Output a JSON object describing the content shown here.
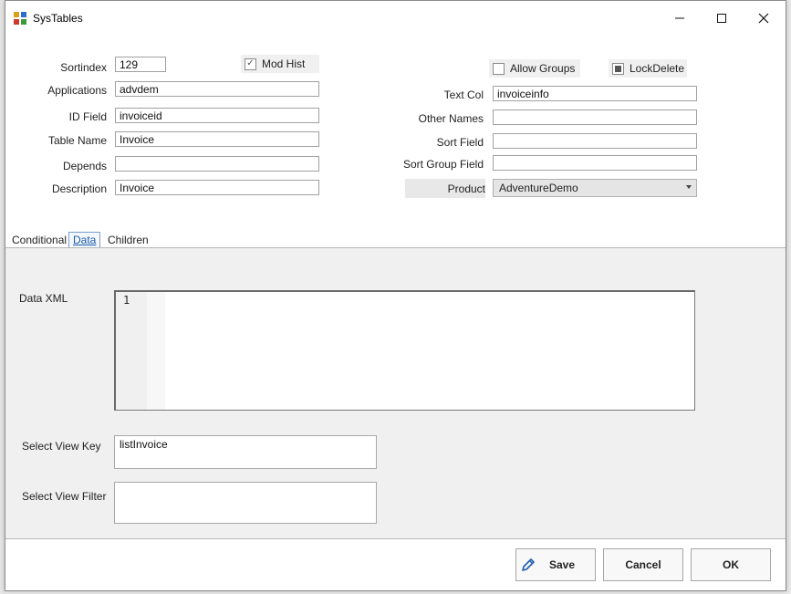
{
  "window": {
    "title": "SysTables"
  },
  "form": {
    "sortindex": {
      "label": "Sortindex",
      "value": "129"
    },
    "mod_hist": {
      "label": "Mod Hist",
      "checked": true
    },
    "applications": {
      "label": "Applications",
      "value": "advdem"
    },
    "id_field": {
      "label": "ID Field",
      "value": "invoiceid"
    },
    "table_name": {
      "label": "Table Name",
      "value": "Invoice"
    },
    "depends": {
      "label": "Depends",
      "value": ""
    },
    "description": {
      "label": "Description",
      "value": "Invoice"
    },
    "allow_groups": {
      "label": "Allow Groups",
      "checked": false
    },
    "lock_delete": {
      "label": "LockDelete",
      "checked": true
    },
    "text_col": {
      "label": "Text Col",
      "value": "invoiceinfo"
    },
    "other_names": {
      "label": "Other Names",
      "value": ""
    },
    "sort_field": {
      "label": "Sort Field",
      "value": ""
    },
    "sort_group_field": {
      "label": "Sort Group Field",
      "value": ""
    },
    "product": {
      "label": "Product",
      "value": "AdventureDemo"
    }
  },
  "tabs": [
    {
      "label": "Conditional",
      "active": false
    },
    {
      "label": "Data",
      "active": true
    },
    {
      "label": "Children",
      "active": false
    }
  ],
  "data_tab": {
    "data_xml": {
      "label": "Data XML",
      "line_number": "1"
    },
    "select_view_key": {
      "label": "Select View Key",
      "value": "listInvoice"
    },
    "select_view_filter": {
      "label": "Select View Filter",
      "value": ""
    }
  },
  "buttons": {
    "save": "Save",
    "cancel": "Cancel",
    "ok": "OK"
  },
  "colors": {
    "accent": "#1a5aa8",
    "panel": "#f0f0f0"
  }
}
